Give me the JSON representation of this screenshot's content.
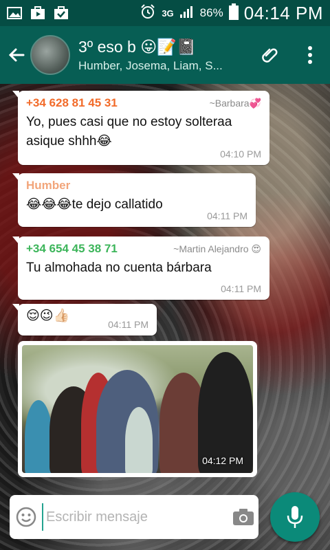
{
  "status_bar": {
    "battery": "86%",
    "network": "3G",
    "time": "04:14 PM",
    "icons": [
      "image-icon",
      "play-store-icon",
      "briefcase-check-icon",
      "alarm-icon",
      "signal-icon",
      "battery-icon"
    ]
  },
  "header": {
    "title": "3º eso b 😛📝📓",
    "subtitle": "Humber, Josema, Liam, S...",
    "colors": {
      "bar": "#075e54",
      "status": "#054d44"
    }
  },
  "messages": [
    {
      "sender": "+34 628 81 45 31",
      "sender_color": "#f26b2a",
      "tag": "~Barbara💞",
      "text": "Yo, pues casi que no estoy solteraa asique shhh😂",
      "time": "04:10 PM"
    },
    {
      "sender": "Humber",
      "sender_color": "#f2a57a",
      "text": "😂😂😂te dejo callatido",
      "time": "04:11 PM"
    },
    {
      "sender": "+34 654 45 38 71",
      "sender_color": "#3cb55a",
      "tag": "~Martin Alejandro 😍",
      "text": "Tu almohada no cuenta bárbara",
      "time": "04:11 PM"
    },
    {
      "text": "😌😉👍🏻",
      "time": "04:11 PM"
    },
    {
      "type": "image",
      "time": "04:12 PM"
    }
  ],
  "composer": {
    "placeholder": "Escribir mensaje",
    "accent": "#0b8a79"
  }
}
